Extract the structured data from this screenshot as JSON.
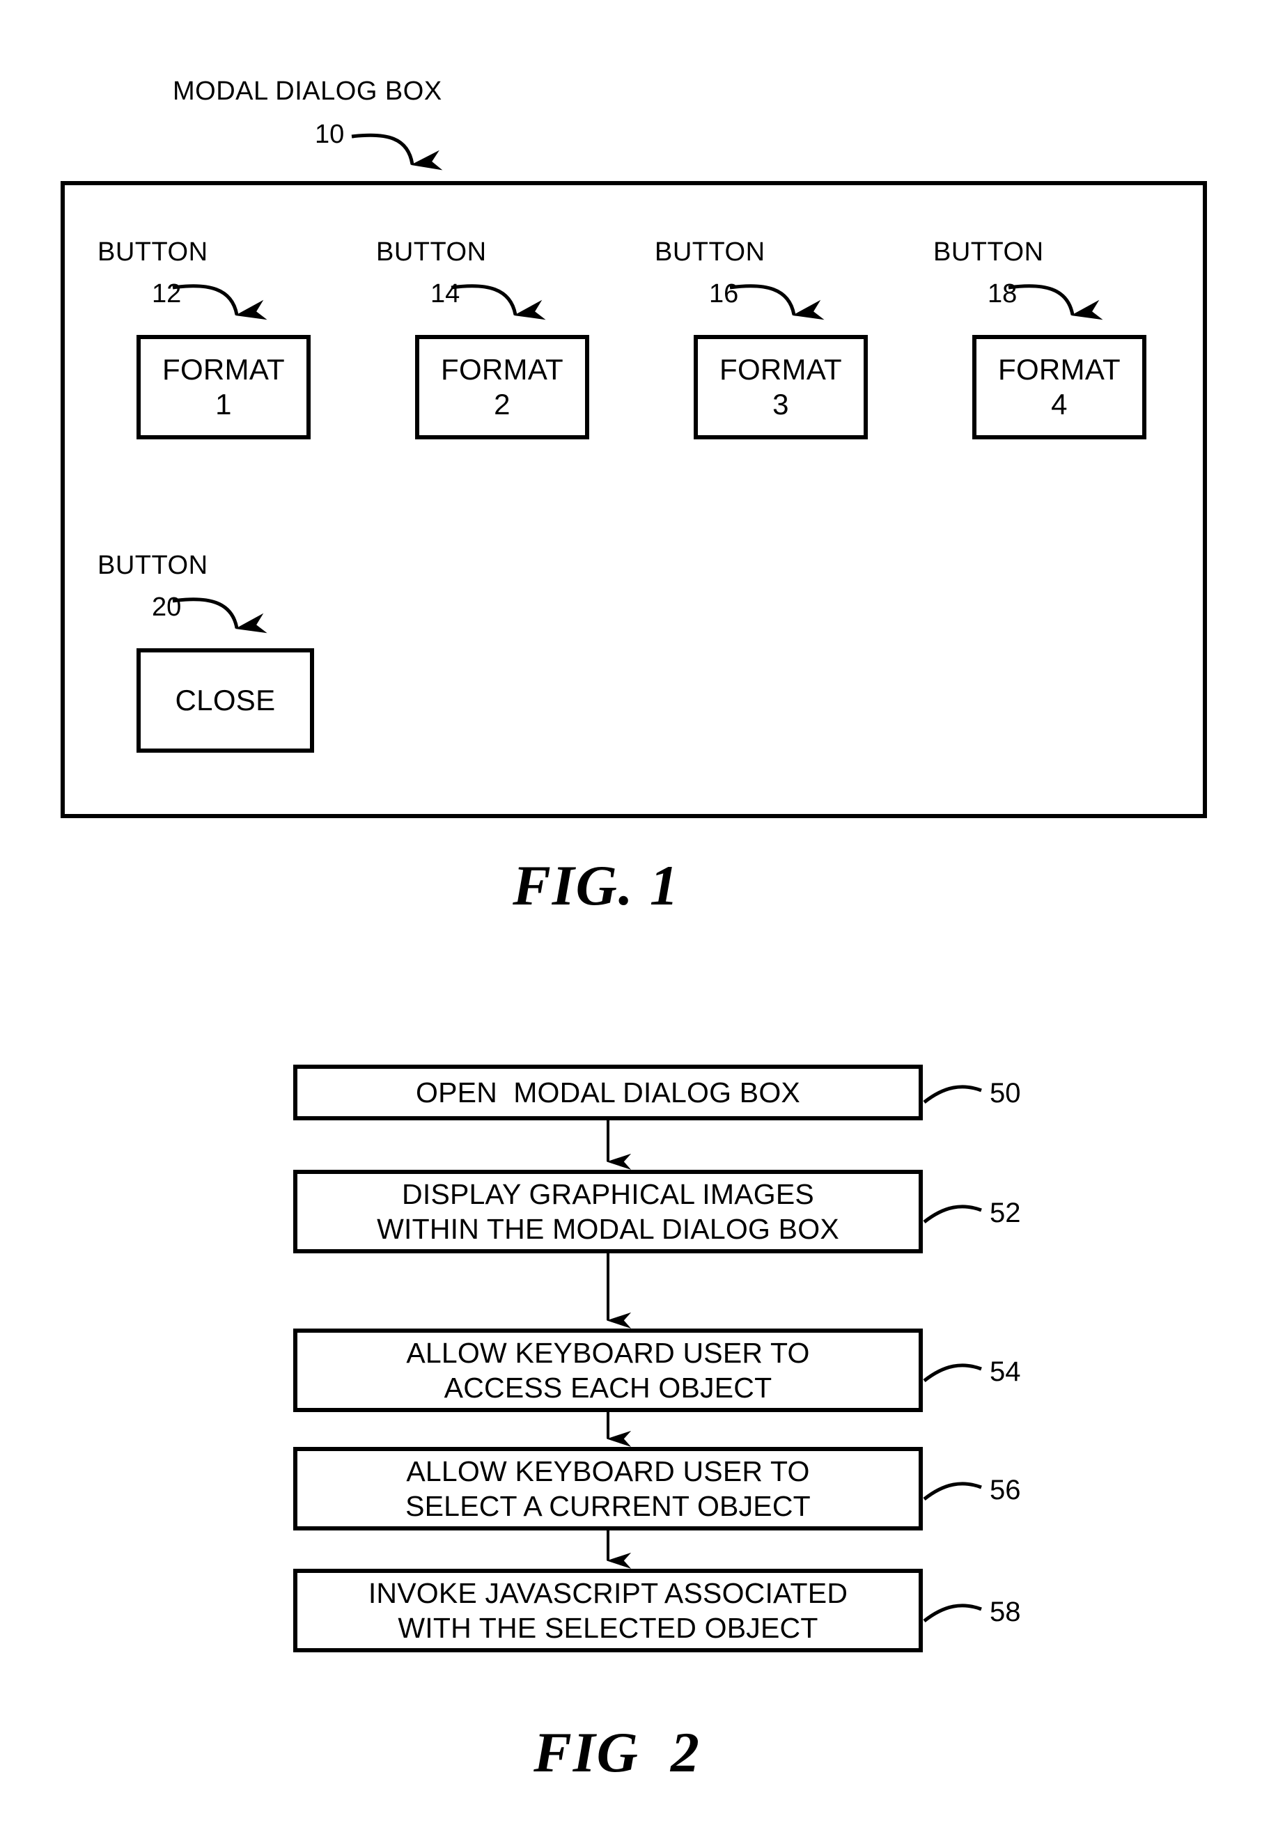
{
  "figure1": {
    "caption": "FIG. 1",
    "dialog_label": "MODAL DIALOG BOX",
    "dialog_ref": "10",
    "buttons": [
      {
        "callout": "BUTTON",
        "ref": "12",
        "label_line1": "FORMAT",
        "label_line2": "1"
      },
      {
        "callout": "BUTTON",
        "ref": "14",
        "label_line1": "FORMAT",
        "label_line2": "2"
      },
      {
        "callout": "BUTTON",
        "ref": "16",
        "label_line1": "FORMAT",
        "label_line2": "3"
      },
      {
        "callout": "BUTTON",
        "ref": "18",
        "label_line1": "FORMAT",
        "label_line2": "4"
      }
    ],
    "close_button": {
      "callout": "BUTTON",
      "ref": "20",
      "label": "CLOSE"
    }
  },
  "figure2": {
    "caption": "FIG  2",
    "steps": [
      {
        "ref": "50",
        "line1": "OPEN  MODAL DIALOG BOX",
        "line2": ""
      },
      {
        "ref": "52",
        "line1": "DISPLAY GRAPHICAL IMAGES",
        "line2": "WITHIN THE MODAL DIALOG BOX"
      },
      {
        "ref": "54",
        "line1": "ALLOW KEYBOARD USER TO",
        "line2": "ACCESS EACH OBJECT"
      },
      {
        "ref": "56",
        "line1": "ALLOW KEYBOARD USER TO",
        "line2": "SELECT A CURRENT OBJECT"
      },
      {
        "ref": "58",
        "line1": "INVOKE JAVASCRIPT ASSOCIATED",
        "line2": "WITH THE SELECTED OBJECT"
      }
    ]
  },
  "colors": {
    "ink": "#000000",
    "paper": "#ffffff"
  }
}
